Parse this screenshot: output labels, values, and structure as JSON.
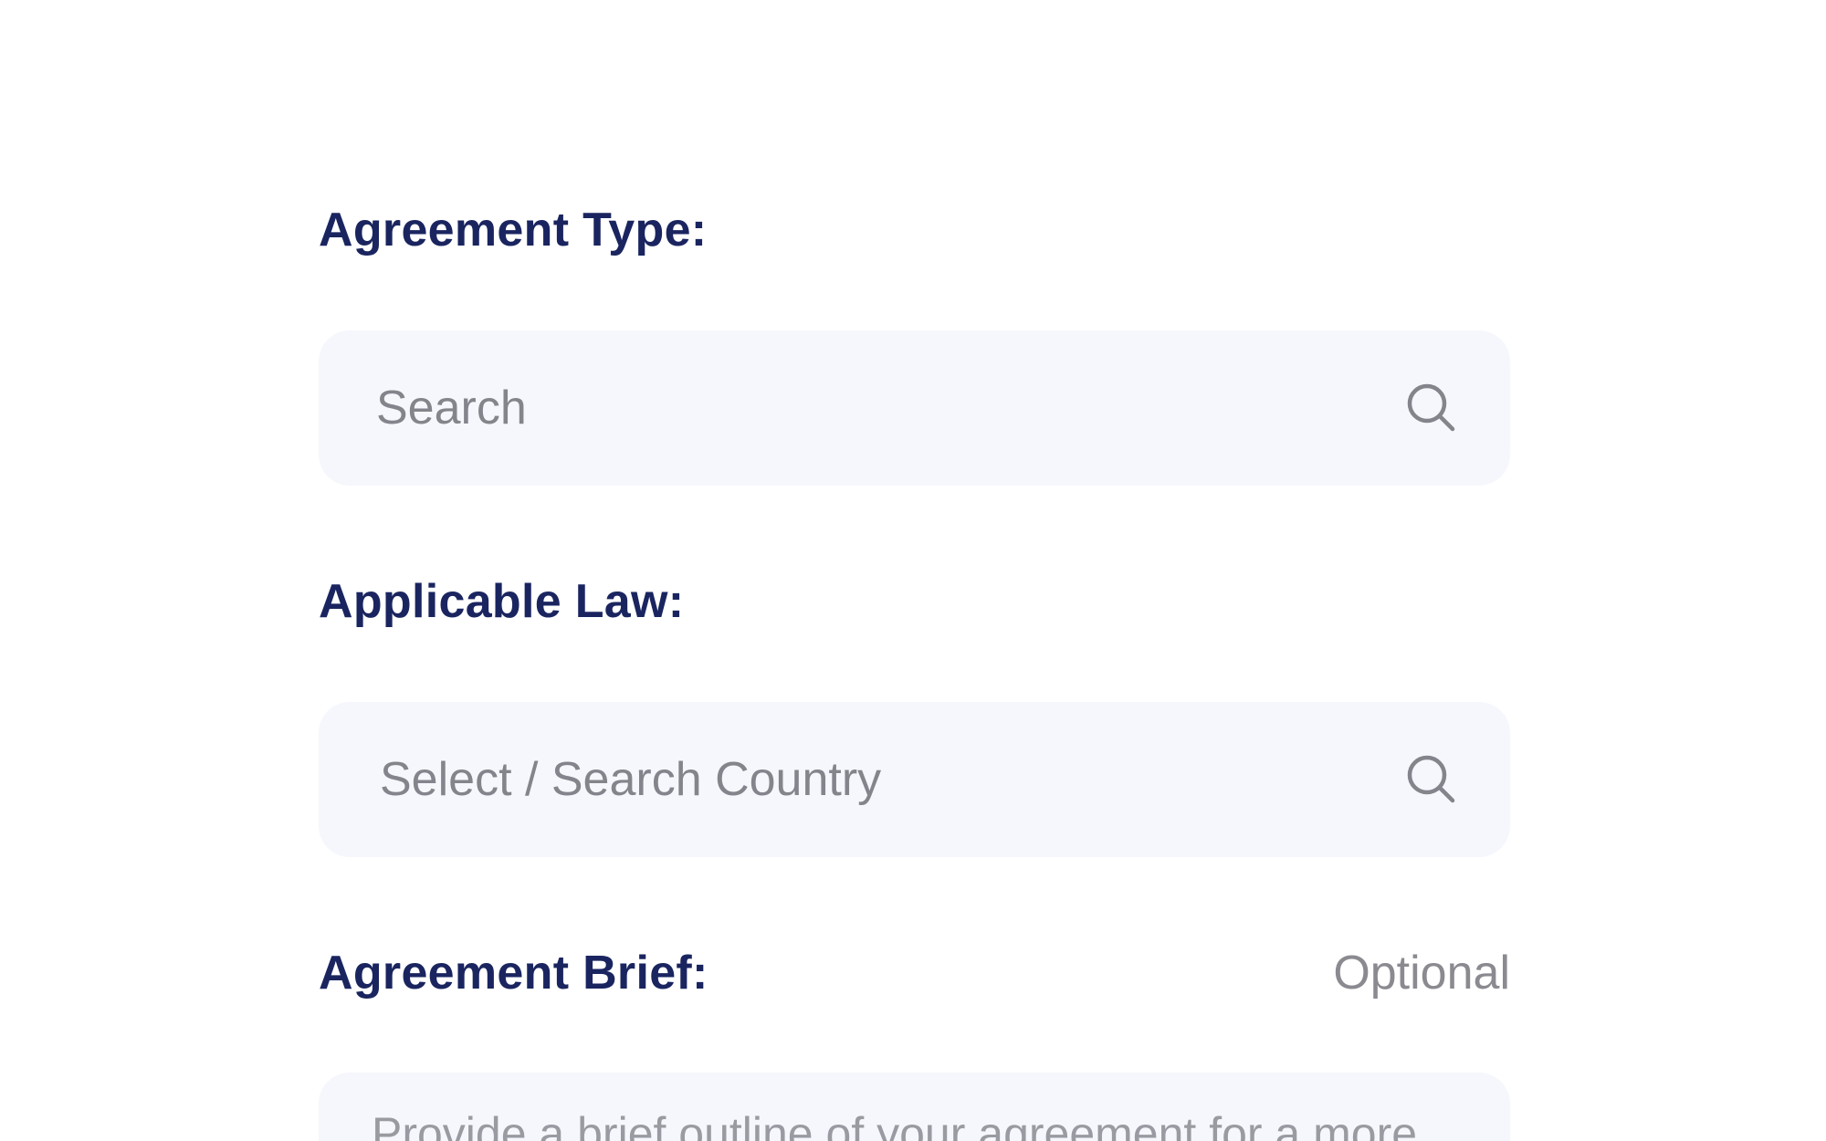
{
  "agreement_type": {
    "label": "Agreement Type:",
    "search_placeholder": "Search",
    "icon": "search-icon"
  },
  "applicable_law": {
    "label": "Applicable Law:",
    "search_placeholder": "Select / Search Country",
    "icon": "search-icon"
  },
  "agreement_brief": {
    "label": "Agreement Brief:",
    "optional_text": "Optional",
    "placeholder": "Provide a brief outline of your agreement for a more"
  },
  "colors": {
    "label": "#1a2560",
    "placeholder": "#84848c",
    "field_background": "#f6f7fc"
  }
}
